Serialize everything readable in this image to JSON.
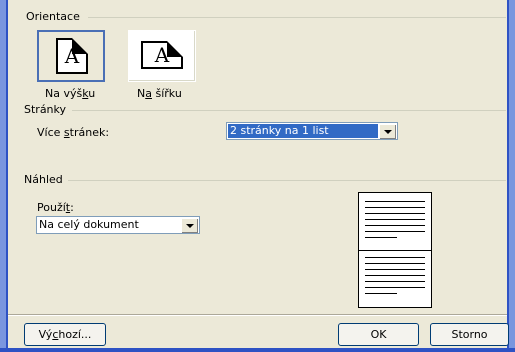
{
  "orientation": {
    "group_label": "Orientace",
    "portrait_label_pre": "Na výš",
    "portrait_label_mn": "k",
    "portrait_label_post": "u",
    "landscape_label_pre": "N",
    "landscape_label_mn": "a",
    "landscape_label_post": " šířku",
    "glyph": "A",
    "selected": "portrait"
  },
  "pages": {
    "group_label": "Stránky",
    "multiple_pages_label_pre": "Více ",
    "multiple_pages_label_mn": "s",
    "multiple_pages_label_post": "tránek:",
    "multiple_pages_value": "2 stránky na 1 list"
  },
  "preview": {
    "group_label": "Náhled",
    "apply_label_pre": "Použí",
    "apply_label_mn": "t",
    "apply_label_post": ":",
    "apply_value": "Na celý dokument"
  },
  "buttons": {
    "default_pre": "Vý",
    "default_mn": "c",
    "default_post": "hozí...",
    "ok": "OK",
    "cancel": "Storno"
  }
}
